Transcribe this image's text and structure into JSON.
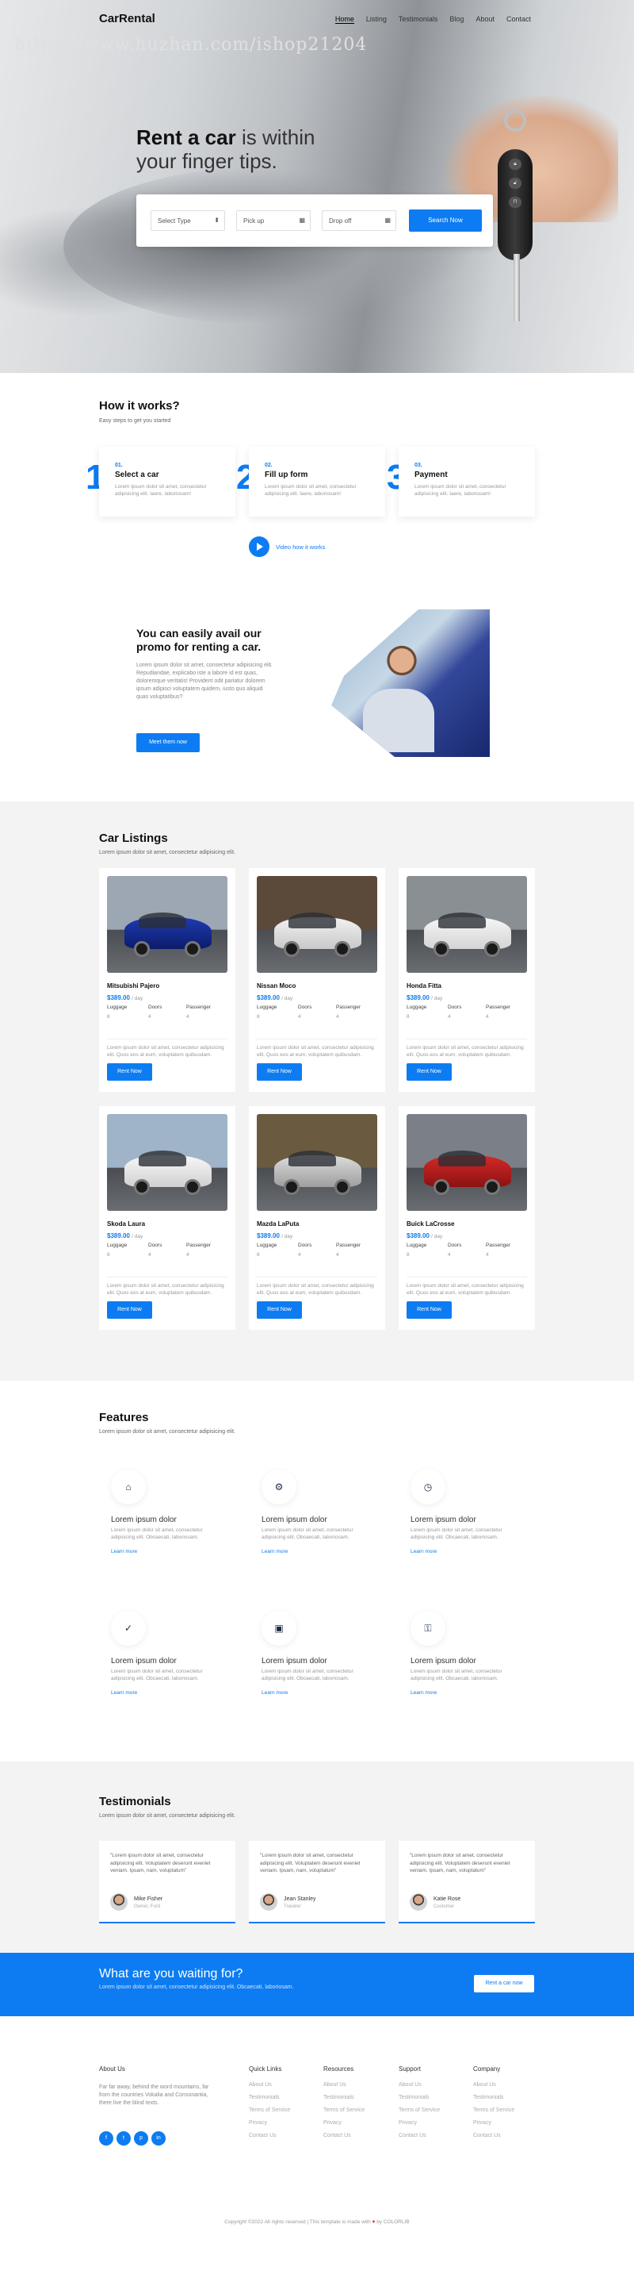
{
  "brand": "CarRental",
  "nav": [
    "Home",
    "Listing",
    "Testimonials",
    "Blog",
    "About",
    "Contact"
  ],
  "watermark": "https://www.huzhan.com/ishop21204",
  "hero": {
    "title_bold": "Rent a car",
    "title_rest": " is within",
    "title_line2": "your finger tips.",
    "select_type": "Select Type",
    "pick_up": "Pick up",
    "drop_off": "Drop off",
    "search_btn": "Search Now"
  },
  "how": {
    "title": "How it works?",
    "subtitle": "Easy steps to get you started",
    "steps": [
      {
        "big": "1",
        "num": "01.",
        "title": "Select a car",
        "text": "Lorem ipsum dolor sit amet, consectetur adipisicing elit. Iaere, laboriosam!"
      },
      {
        "big": "2",
        "num": "02.",
        "title": "Fill up form",
        "text": "Lorem ipsum dolor sit amet, consectetur adipisicing elit. Iaere, laboriosam!"
      },
      {
        "big": "3",
        "num": "03.",
        "title": "Payment",
        "text": "Lorem ipsum dolor sit amet, consectetur adipisicing elit. Iaere, laboriosam!"
      }
    ],
    "video_label": "Video how it works"
  },
  "promo": {
    "title": "You can easily avail our promo for renting a car.",
    "text": "Lorem ipsum dolor sit amet, consectetur adipisicing elit. Repudiandae, explicabo iste a labore id est quas, doloremque veritatis! Provident odit pariatur dolorem ipsum adipisci voluptatem quidem, iusto quo aliquid quas voluptatibus?",
    "button": "Meet them now"
  },
  "listings": {
    "title": "Car Listings",
    "subtitle": "Lorem ipsum dolor sit amet, consectetur adipisicing elit.",
    "spec_labels": [
      "Luggage",
      "Doors",
      "Passenger"
    ],
    "desc": "Lorem ipsum dolor sit amet, consectetur adipisicing elit. Quos eos at eum, voluptatem quibusdam.",
    "rent_label": "Rent Now",
    "per_day": "/ day",
    "cars": [
      {
        "name": "Mitsubishi Pajero",
        "price": "$389.00",
        "specs": [
          "8",
          "4",
          "4"
        ],
        "c1": "#1f3bb3",
        "c2": "#0c1c6b",
        "bg": "#9da7b3"
      },
      {
        "name": "Nissan Moco",
        "price": "$389.00",
        "specs": [
          "8",
          "4",
          "4"
        ],
        "c1": "#f2f2f2",
        "c2": "#c8c8c8",
        "bg": "#5b4a3a"
      },
      {
        "name": "Honda Fitta",
        "price": "$389.00",
        "specs": [
          "8",
          "4",
          "4"
        ],
        "c1": "#f6f6f6",
        "c2": "#d4d4d4",
        "bg": "#8a8f93"
      },
      {
        "name": "Skoda Laura",
        "price": "$389.00",
        "specs": [
          "8",
          "4",
          "4"
        ],
        "c1": "#f7f7f7",
        "c2": "#d0d0d0",
        "bg": "#9fb3c9"
      },
      {
        "name": "Mazda LaPuta",
        "price": "$389.00",
        "specs": [
          "8",
          "4",
          "4"
        ],
        "c1": "#dcdcdc",
        "c2": "#9e9e9e",
        "bg": "#6a5a40"
      },
      {
        "name": "Buick LaCrosse",
        "price": "$389.00",
        "specs": [
          "8",
          "4",
          "4"
        ],
        "c1": "#d62828",
        "c2": "#8a1212",
        "bg": "#7b8088"
      }
    ]
  },
  "features": {
    "title": "Features",
    "subtitle": "Lorem ipsum dolor sit amet, consectetur adipisicing elit.",
    "items": [
      {
        "icon": "⌂",
        "name": "home-icon",
        "title": "Lorem ipsum dolor",
        "text": "Lorem ipsum dolor sit amet, consectetur adipisicing elit. Obcaecati, laboriosam.",
        "link": "Learn more"
      },
      {
        "icon": "⚙",
        "name": "gear-icon",
        "title": "Lorem ipsum dolor",
        "text": "Lorem ipsum dolor sit amet, consectetur adipisicing elit. Obcaecati, laboriosam.",
        "link": "Learn more"
      },
      {
        "icon": "◷",
        "name": "clock-icon",
        "title": "Lorem ipsum dolor",
        "text": "Lorem ipsum dolor sit amet, consectetur adipisicing elit. Obcaecati, laboriosam.",
        "link": "Learn more"
      },
      {
        "icon": "✓",
        "name": "shield-check-icon",
        "title": "Lorem ipsum dolor",
        "text": "Lorem ipsum dolor sit amet, consectetur adipisicing elit. Obcaecati, laboriosam.",
        "link": "Learn more"
      },
      {
        "icon": "▣",
        "name": "library-icon",
        "title": "Lorem ipsum dolor",
        "text": "Lorem ipsum dolor sit amet, consectetur adipisicing elit. Obcaecati, laboriosam.",
        "link": "Learn more"
      },
      {
        "icon": "⚿",
        "name": "key-icon",
        "title": "Lorem ipsum dolor",
        "text": "Lorem ipsum dolor sit amet, consectetur adipisicing elit. Obcaecati, laboriosam.",
        "link": "Learn more"
      }
    ]
  },
  "testimonials": {
    "title": "Testimonials",
    "subtitle": "Lorem ipsum dolor sit amet, consectetur adipisicing elit.",
    "items": [
      {
        "quote": "\"Lorem ipsum dolor sit amet, consectetur adipisicing elit. Voluptatem deserunt eveniet veniam. Ipsam, nam, voluptatum\"",
        "name": "Mike Fisher",
        "role": "Owner, Ford"
      },
      {
        "quote": "\"Lorem ipsum dolor sit amet, consectetur adipisicing elit. Voluptatem deserunt eveniet veniam. Ipsam, nam, voluptatum\"",
        "name": "Jean Stanley",
        "role": "Traveler"
      },
      {
        "quote": "\"Lorem ipsum dolor sit amet, consectetur adipisicing elit. Voluptatem deserunt eveniet veniam. Ipsam, nam, voluptatum\"",
        "name": "Katie Rose",
        "role": "Customer"
      }
    ]
  },
  "cta": {
    "title": "What are you waiting for?",
    "subtitle": "Lorem ipsum dolor sit amet, consectetur adipisicing elit. Obcaecati, laboriosam.",
    "button": "Rent a car now"
  },
  "footer": {
    "about_title": "About Us",
    "about_text": "Far far away, behind the word mountains, far from the countries Vokalia and Consonantia, there live the blind texts.",
    "social": [
      "f",
      "t",
      "p",
      "in"
    ],
    "cols": [
      {
        "title": "Quick Links",
        "links": [
          "About Us",
          "Testimonials",
          "Terms of Service",
          "Privacy",
          "Contact Us"
        ]
      },
      {
        "title": "Resources",
        "links": [
          "About Us",
          "Testimonials",
          "Terms of Service",
          "Privacy",
          "Contact Us"
        ]
      },
      {
        "title": "Support",
        "links": [
          "About Us",
          "Testimonials",
          "Terms of Service",
          "Privacy",
          "Contact Us"
        ]
      },
      {
        "title": "Company",
        "links": [
          "About Us",
          "Testimonials",
          "Terms of Service",
          "Privacy",
          "Contact Us"
        ]
      }
    ],
    "copyright_pre": "Copyright ©2022 All rights reserved | This template is made with ",
    "copyright_heart": "♥",
    "copyright_post": " by COLORLIB"
  }
}
